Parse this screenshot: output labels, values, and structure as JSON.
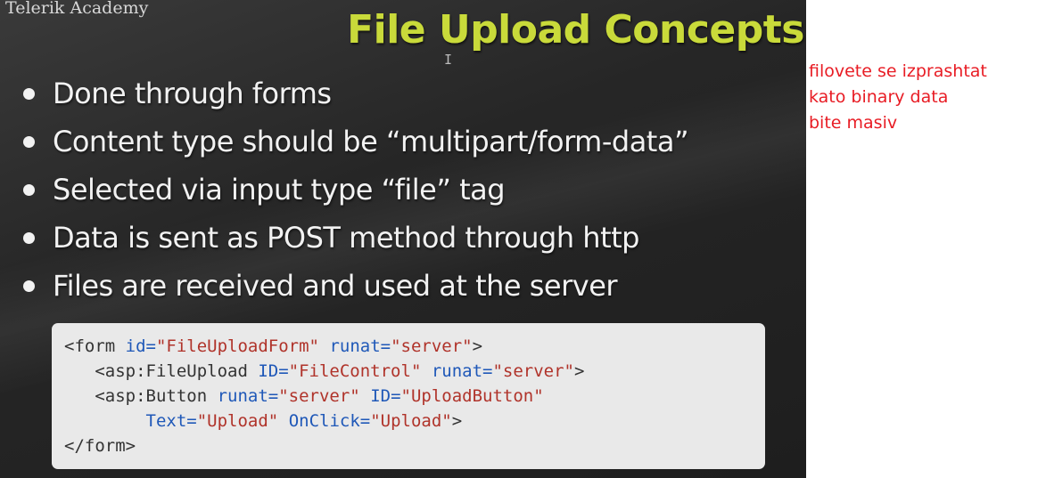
{
  "slide": {
    "brand": "Telerik Academy",
    "title": "File Upload Concepts",
    "cursor_glyph": "I",
    "bullets": [
      "Done through forms",
      "Content type should be “multipart/form-data”",
      "Selected via input type “file” tag",
      "Data is sent as POST method through http",
      "Files are received and used at the server"
    ],
    "code": {
      "l1": {
        "t1": "<form ",
        "a1": "id=",
        "v1": "\"FileUploadForm\"",
        "t2": " ",
        "a2": "runat=",
        "v2": "\"server\"",
        "t3": ">"
      },
      "l2": {
        "t1": "   <asp:FileUpload ",
        "a1": "ID=",
        "v1": "\"FileControl\"",
        "t2": " ",
        "a2": "runat=",
        "v2": "\"server\"",
        "t3": ">"
      },
      "l3": {
        "t1": "   <asp:Button ",
        "a1": "runat=",
        "v1": "\"server\"",
        "t2": " ",
        "a2": "ID=",
        "v2": "\"UploadButton\""
      },
      "l4": {
        "t1": "        ",
        "a1": "Text=",
        "v1": "\"Upload\"",
        "t2": " ",
        "a2": "OnClick=",
        "v2": "\"Upload\"",
        "t3": ">"
      },
      "l5": {
        "t1": "</form>"
      }
    }
  },
  "notes": [
    "filovete se izprashtat",
    "kato binary data",
    "bite masiv"
  ],
  "colors": {
    "title": "#c9da3a",
    "note_text": "#e81c24",
    "code_background": "#e9e9e9",
    "code_attr": "#1f58b8",
    "code_value": "#b0332a"
  }
}
